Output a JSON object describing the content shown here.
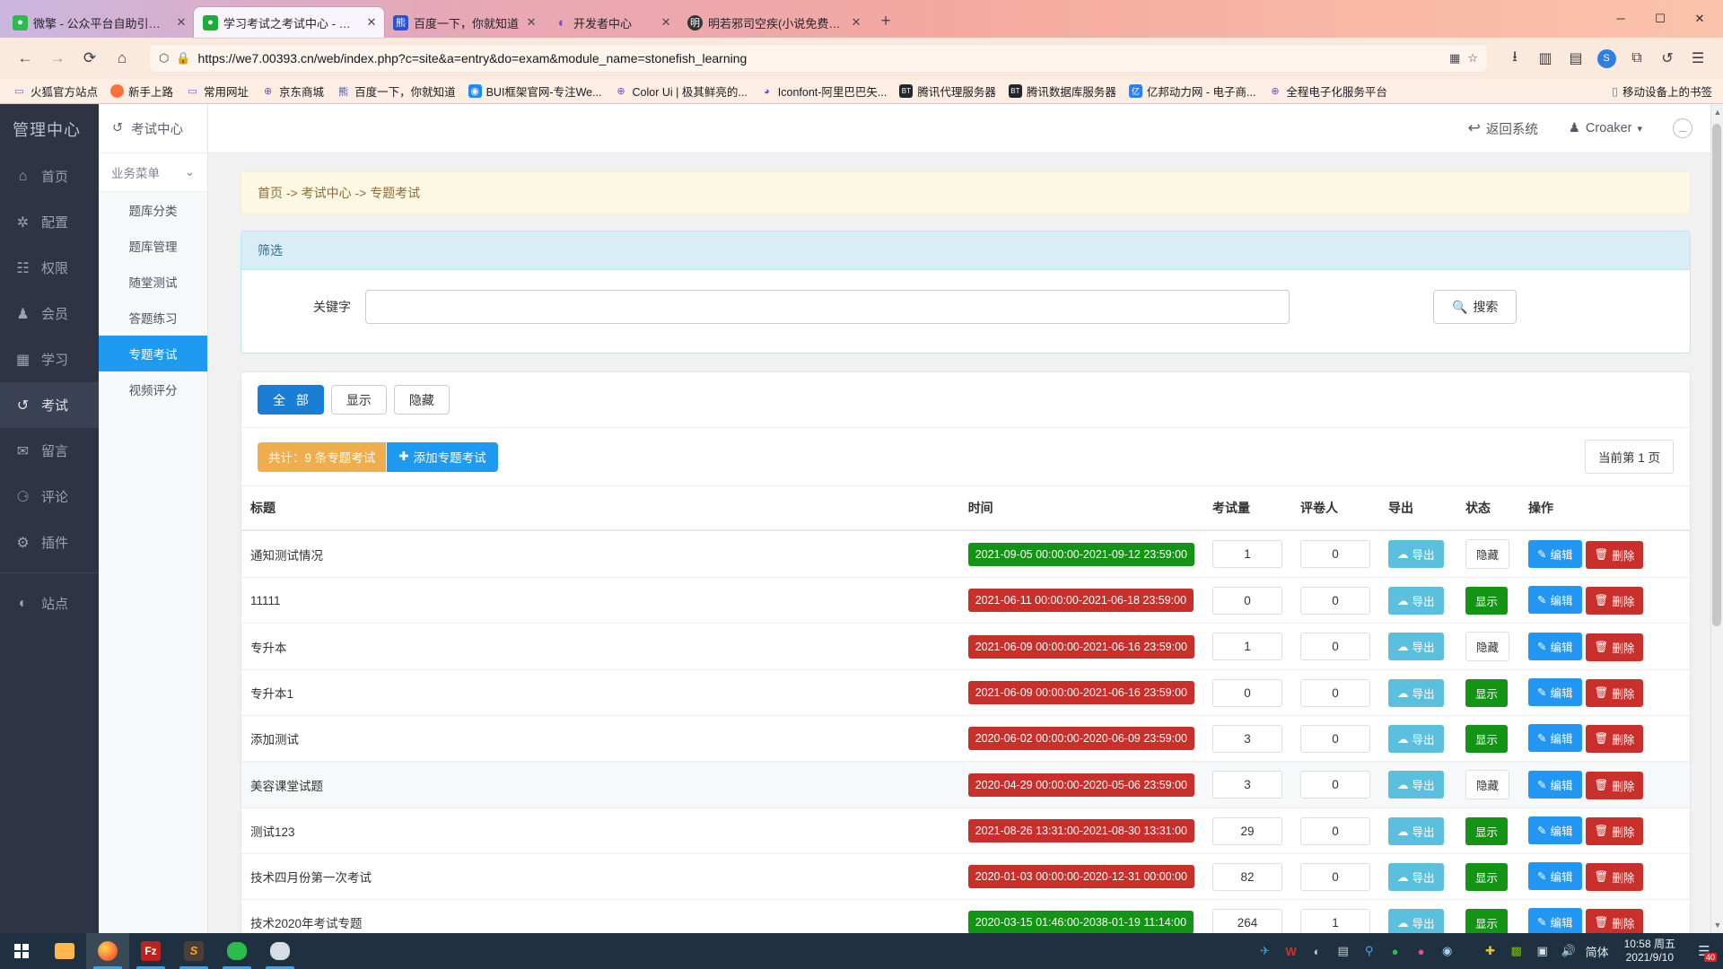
{
  "browser": {
    "tabs": [
      {
        "title": "微擎 - 公众平台自助引擎 - Pow",
        "favicon": "wechat-icon",
        "color": "#2dbb4e",
        "active": false,
        "close": "✕"
      },
      {
        "title": "学习考试之考试中心 - 微擎 - 公",
        "favicon": "wechat-icon",
        "color": "#1faa3c",
        "active": true,
        "close": "✕"
      },
      {
        "title": "百度一下，你就知道",
        "favicon": "baidu-icon",
        "color": "#2b52d0",
        "active": false,
        "close": "✕"
      },
      {
        "title": "开发者中心",
        "favicon": "dev-icon",
        "color": "#6f4fd0",
        "active": false,
        "close": "✕"
      },
      {
        "title": "明若邪司空疾(小说免费阅读)最",
        "favicon": "book-icon",
        "color": "#333333",
        "active": false,
        "close": "✕"
      }
    ],
    "new_tab_label": "+",
    "window_controls": {
      "minimize": "─",
      "maximize": "☐",
      "close": "✕"
    },
    "nav": {
      "back": "←",
      "forward": "→",
      "reload": "⟳",
      "home": "⌂"
    },
    "url": "https://we7.00393.cn/web/index.php?c=site&a=entry&do=exam&module_name=stonefish_learning",
    "url_shield": "⬡",
    "url_lock": "🔒",
    "toolbar_right": {
      "qr": "▦",
      "star": "☆",
      "download": "⭳",
      "library": "▥",
      "sidebar": "▤",
      "account_badge": "S",
      "extensions": "⧉",
      "history": "↺",
      "menu": "☰"
    },
    "bookmarks": [
      {
        "label": "火狐官方站点",
        "icon": "folder-icon",
        "color": "#7a5cd1"
      },
      {
        "label": "新手上路",
        "icon": "firefox-icon",
        "color": "#ff7139"
      },
      {
        "label": "常用网址",
        "icon": "folder-icon",
        "color": "#7a5cd1"
      },
      {
        "label": "京东商城",
        "icon": "globe-icon",
        "color": "#6a4fd0"
      },
      {
        "label": "百度一下，你就知道",
        "icon": "baidu-icon",
        "color": "#2b52d0"
      },
      {
        "label": "BUI框架官网-专注We...",
        "icon": "bui-icon",
        "color": "#1a8cff"
      },
      {
        "label": "Color Ui | 极其鲜亮的...",
        "icon": "globe-icon",
        "color": "#6a4fd0"
      },
      {
        "label": "Iconfont-阿里巴巴矢...",
        "icon": "iconfont-icon",
        "color": "#8b3ddc"
      },
      {
        "label": "腾讯代理服务器",
        "icon": "bt-icon",
        "color": "#22262b"
      },
      {
        "label": "腾讯数据库服务器",
        "icon": "bt-icon",
        "color": "#22262b"
      },
      {
        "label": "亿邦动力网 - 电子商...",
        "icon": "yibang-icon",
        "color": "#2f80ed"
      },
      {
        "label": "全程电子化服务平台",
        "icon": "globe-icon",
        "color": "#6a4fd0"
      }
    ],
    "bookmarks_right": {
      "label": "移动设备上的书签",
      "icon": "mobile-icon"
    }
  },
  "sidebar_dark": {
    "logo": "管理中心",
    "items": [
      {
        "label": "首页",
        "icon": "home-icon",
        "glyph": "⌂",
        "active": false
      },
      {
        "label": "配置",
        "icon": "gear-icon",
        "glyph": "✿",
        "active": false
      },
      {
        "label": "权限",
        "icon": "sitemap-icon",
        "glyph": "⛬",
        "active": false
      },
      {
        "label": "会员",
        "icon": "user-icon",
        "glyph": "👤",
        "active": false
      },
      {
        "label": "学习",
        "icon": "calendar-icon",
        "glyph": "▦",
        "active": false
      },
      {
        "label": "考试",
        "icon": "history-icon",
        "glyph": "↺",
        "active": true
      },
      {
        "label": "留言",
        "icon": "envelope-icon",
        "glyph": "✉",
        "active": false
      },
      {
        "label": "评论",
        "icon": "comments-icon",
        "glyph": "💬",
        "active": false
      },
      {
        "label": "插件",
        "icon": "plugin-icon",
        "glyph": "⚙",
        "active": false
      }
    ],
    "footer_items": [
      {
        "label": "站点",
        "icon": "globe-dark-icon",
        "glyph": "◕",
        "active": false
      }
    ]
  },
  "sidebar_light": {
    "header": {
      "label": "考试中心",
      "icon": "back-arrow-icon",
      "glyph": "↺"
    },
    "group": {
      "label": "业务菜单",
      "chevron": "⌄"
    },
    "items": [
      {
        "label": "题库分类",
        "active": false
      },
      {
        "label": "题库管理",
        "active": false
      },
      {
        "label": "随堂测试",
        "active": false
      },
      {
        "label": "答题练习",
        "active": false
      },
      {
        "label": "专题考试",
        "active": true
      },
      {
        "label": "视频评分",
        "active": false
      }
    ]
  },
  "topbar": {
    "back_system": "返回系统",
    "back_icon": "reply-arrow-icon",
    "user": "Croaker",
    "user_icon": "user-icon",
    "user_caret": "▾",
    "help_icon": "minus-circle-icon"
  },
  "breadcrumb": "首页 -> 考试中心 -> 专题考试",
  "filter_panel": {
    "title": "筛选",
    "keyword_label": "关键字",
    "keyword_value": "",
    "keyword_placeholder": "",
    "search_label": "搜索",
    "search_icon": "search-icon"
  },
  "toolbar": {
    "tabs": [
      {
        "label": "全 部",
        "active": true
      },
      {
        "label": "显示",
        "active": false
      },
      {
        "label": "隐藏",
        "active": false
      }
    ],
    "total_badge": "共计：9 条专题考试",
    "add_label": "添加专题考试",
    "add_icon": "plus-icon",
    "pager": "当前第 1 页"
  },
  "table": {
    "columns": [
      "标题",
      "时间",
      "考试量",
      "评卷人",
      "导出",
      "状态",
      "操作"
    ],
    "export_label": "导出",
    "export_icon": "cloud-download-icon",
    "edit_label": "编辑",
    "edit_icon": "pencil-square-icon",
    "delete_label": "删除",
    "delete_icon": "trash-icon",
    "rows": [
      {
        "title": "通知测试情况",
        "time": "2021-09-05 00:00:00-2021-09-12 23:59:00",
        "time_color": "green",
        "exam_count": "1",
        "reviewers": "0",
        "status": "隐藏",
        "status_kind": "hide"
      },
      {
        "title": "11111",
        "time": "2021-06-11 00:00:00-2021-06-18 23:59:00",
        "time_color": "red",
        "exam_count": "0",
        "reviewers": "0",
        "status": "显示",
        "status_kind": "show"
      },
      {
        "title": "专升本",
        "time": "2021-06-09 00:00:00-2021-06-16 23:59:00",
        "time_color": "red",
        "exam_count": "1",
        "reviewers": "0",
        "status": "隐藏",
        "status_kind": "hide"
      },
      {
        "title": "专升本1",
        "time": "2021-06-09 00:00:00-2021-06-16 23:59:00",
        "time_color": "red",
        "exam_count": "0",
        "reviewers": "0",
        "status": "显示",
        "status_kind": "show"
      },
      {
        "title": "添加测试",
        "time": "2020-06-02 00:00:00-2020-06-09 23:59:00",
        "time_color": "red",
        "exam_count": "3",
        "reviewers": "0",
        "status": "显示",
        "status_kind": "show"
      },
      {
        "title": "美容课堂试题",
        "time": "2020-04-29 00:00:00-2020-05-06 23:59:00",
        "time_color": "red",
        "exam_count": "3",
        "reviewers": "0",
        "status": "隐藏",
        "status_kind": "hide"
      },
      {
        "title": "测试123",
        "time": "2021-08-26 13:31:00-2021-08-30 13:31:00",
        "time_color": "red",
        "exam_count": "29",
        "reviewers": "0",
        "status": "显示",
        "status_kind": "show"
      },
      {
        "title": "技术四月份第一次考试",
        "time": "2020-01-03 00:00:00-2020-12-31 00:00:00",
        "time_color": "red",
        "exam_count": "82",
        "reviewers": "0",
        "status": "显示",
        "status_kind": "show"
      },
      {
        "title": "技术2020年考试专题",
        "time": "2020-03-15 01:46:00-2038-01-19 11:14:00",
        "time_color": "green",
        "exam_count": "264",
        "reviewers": "1",
        "status": "显示",
        "status_kind": "show"
      }
    ]
  },
  "taskbar": {
    "start_icon": "windows-icon",
    "apps": [
      {
        "name": "file-explorer-icon",
        "glyph": "🗂",
        "color": "#ffb74d",
        "active": false
      },
      {
        "name": "firefox-icon",
        "glyph": "🦊",
        "color": "#ff7139",
        "active": true
      },
      {
        "name": "filezilla-icon",
        "glyph": "Fz",
        "color": "#bf2121",
        "active": false
      },
      {
        "name": "sublime-icon",
        "glyph": "S",
        "color": "#4b3f35",
        "active": false
      },
      {
        "name": "wechat-icon",
        "glyph": "💬",
        "color": "#2dbb4e",
        "active": false
      },
      {
        "name": "chat-icon",
        "glyph": "💬",
        "color": "#d6dde4",
        "active": false
      }
    ],
    "tray": [
      {
        "name": "telegram-icon",
        "glyph": "✈",
        "color": "#2f9fe0"
      },
      {
        "name": "wps-icon",
        "glyph": "W",
        "color": "#d93025"
      },
      {
        "name": "network-dish-icon",
        "glyph": "📡",
        "color": "#c8ccd2"
      },
      {
        "name": "printer-icon",
        "glyph": "🖨",
        "color": "#c8ccd2"
      },
      {
        "name": "search-tool-icon",
        "glyph": "🔍",
        "color": "#4da3e8"
      },
      {
        "name": "wechat-icon",
        "glyph": "💬",
        "color": "#2dbb4e"
      },
      {
        "name": "qq-icon",
        "glyph": "🐧",
        "color": "#e84a8a"
      },
      {
        "name": "media-icon",
        "glyph": "◎",
        "color": "#a5d3ef"
      }
    ],
    "tray_right": [
      {
        "name": "security-icon",
        "glyph": "✚",
        "color": "#f0c419"
      },
      {
        "name": "nvidia-icon",
        "glyph": "▣",
        "color": "#76b900"
      },
      {
        "name": "monitor-icon",
        "glyph": "🖵",
        "color": "#dbe3ea"
      },
      {
        "name": "volume-icon",
        "glyph": "🔊",
        "color": "#dbe3ea"
      }
    ],
    "ime_label": "简体",
    "clock_time": "10:58 周五",
    "clock_date": "2021/9/10",
    "notification_icon": "notification-icon",
    "notification_count": "40"
  }
}
